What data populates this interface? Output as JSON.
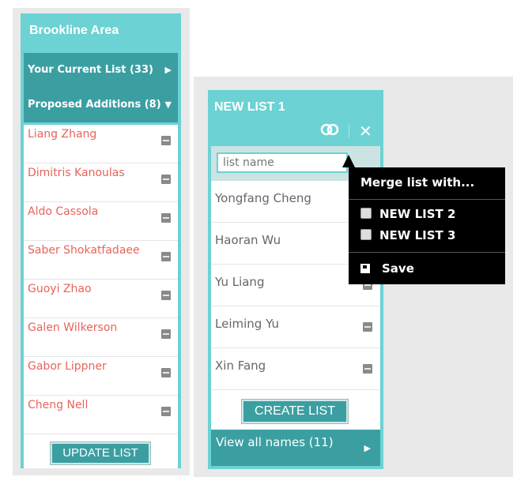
{
  "left_panel": {
    "title": "Brookline Area",
    "nav": {
      "current_list": "Your Current List (33)",
      "proposed_additions": "Proposed Additions (8)"
    },
    "names": [
      "Liang Zhang",
      "Dimitris Kanoulas",
      "Aldo Cassola",
      "Saber Shokatfadaee",
      "Guoyi Zhao",
      "Galen Wilkerson",
      "Gabor Lippner",
      "Cheng Nell"
    ],
    "update_button": "UPDATE LIST"
  },
  "right_panel": {
    "title": "NEW LIST 1",
    "input_placeholder": "list name",
    "names": [
      "Yongfang Cheng",
      "Haoran Wu",
      "Yu Liang",
      "Leiming Yu",
      "Xin Fang"
    ],
    "create_button": "CREATE LIST",
    "view_all": "View all names (11)"
  },
  "dropdown": {
    "heading": "Merge list with...",
    "options": [
      "NEW LIST 2",
      "NEW LIST 3"
    ],
    "save_label": "Save"
  },
  "colors": {
    "panel_teal": "#6cd2d3",
    "dark_teal": "#3b9fa2",
    "name_red": "#e8635a"
  },
  "icons": {
    "merge": "merge-icon",
    "close": "close-icon",
    "remove": "minus-icon",
    "save": "save-icon",
    "arrow_right": "caret-right-icon",
    "arrow_down": "caret-down-icon"
  }
}
